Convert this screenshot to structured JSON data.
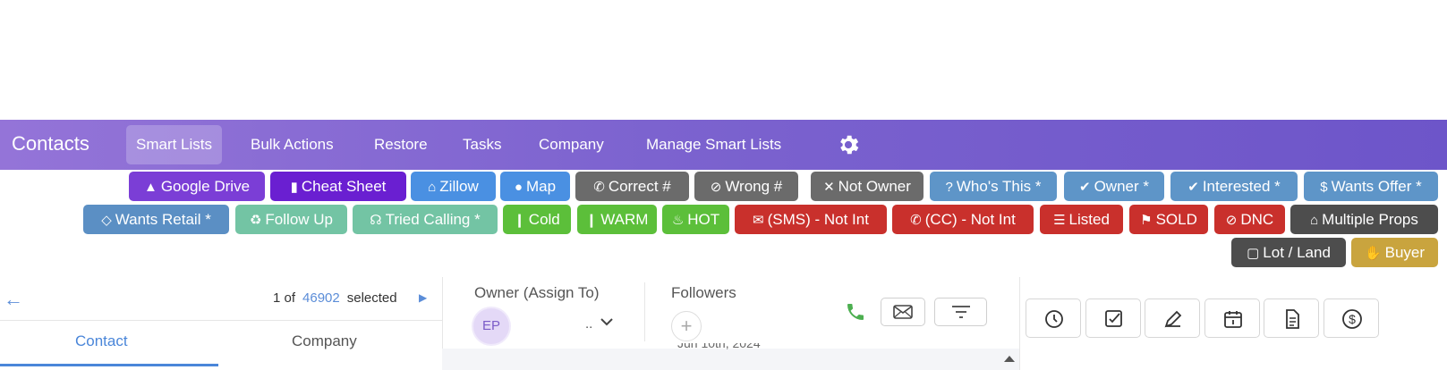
{
  "header": {
    "title": "Contacts",
    "nav": [
      {
        "label": "Smart Lists",
        "active": true
      },
      {
        "label": "Bulk Actions",
        "active": false
      },
      {
        "label": "Restore",
        "active": false
      },
      {
        "label": "Tasks",
        "active": false
      },
      {
        "label": "Company",
        "active": false
      },
      {
        "label": "Manage Smart Lists",
        "active": false
      }
    ],
    "settings_icon": "gear-icon"
  },
  "tags": [
    {
      "label": "Google Drive",
      "icon": "drive-icon",
      "color": "#7b3ed6"
    },
    {
      "label": "Cheat Sheet",
      "icon": "book-icon",
      "color": "#6a1fd1"
    },
    {
      "label": "Zillow",
      "icon": "home-icon",
      "color": "#4a90e2"
    },
    {
      "label": "Map",
      "icon": "map-pin-icon",
      "color": "#4a90e2"
    },
    {
      "label": "Correct #",
      "icon": "phone-icon",
      "color": "#6b6b6b"
    },
    {
      "label": "Wrong #",
      "icon": "phone-slash-icon",
      "color": "#6b6b6b"
    },
    {
      "label": "Not Owner",
      "icon": "x-icon",
      "color": "#6b6b6b"
    },
    {
      "label": "Who's This *",
      "icon": "question-icon",
      "color": "#5e95c8"
    },
    {
      "label": "Owner *",
      "icon": "check-icon",
      "color": "#5e95c8"
    },
    {
      "label": "Interested *",
      "icon": "check-icon",
      "color": "#5e95c8"
    },
    {
      "label": "Wants Offer *",
      "icon": "dollar-icon",
      "color": "#5e95c8"
    },
    {
      "label": "Wants Retail *",
      "icon": "diamond-icon",
      "color": "#5b8fc4"
    },
    {
      "label": "Follow Up",
      "icon": "recycle-icon",
      "color": "#73c4a4"
    },
    {
      "label": "Tried Calling *",
      "icon": "headset-icon",
      "color": "#73c4a4"
    },
    {
      "label": "Cold",
      "icon": "thermometer-icon",
      "color": "#5cbf3a"
    },
    {
      "label": "WARM",
      "icon": "thermometer-icon",
      "color": "#5cbf3a"
    },
    {
      "label": "HOT",
      "icon": "fire-icon",
      "color": "#5cbf3a"
    },
    {
      "label": "(SMS) - Not Int",
      "icon": "comments-icon",
      "color": "#c9302c"
    },
    {
      "label": "(CC) - Not Int",
      "icon": "phone-icon",
      "color": "#c9302c"
    },
    {
      "label": "Listed",
      "icon": "list-icon",
      "color": "#c9302c"
    },
    {
      "label": "SOLD",
      "icon": "flag-icon",
      "color": "#c9302c"
    },
    {
      "label": "DNC",
      "icon": "ban-icon",
      "color": "#c9302c"
    },
    {
      "label": "Multiple Props",
      "icon": "home-icon",
      "color": "#4d4d4d"
    },
    {
      "label": "Lot / Land",
      "icon": "vector-square-icon",
      "color": "#4d4d4d"
    },
    {
      "label": "Buyer",
      "icon": "handshake-icon",
      "color": "#c9a43e"
    }
  ],
  "pager": {
    "prefix": "1 of",
    "total": "46902",
    "suffix": "selected"
  },
  "tabs": {
    "contact": "Contact",
    "company": "Company"
  },
  "owner": {
    "label": "Owner (Assign To)",
    "initials": "EP",
    "value": ".."
  },
  "followers": {
    "label": "Followers"
  },
  "activity": {
    "date_partial": "Jun 10th, 2024"
  },
  "actions": [
    "history-icon",
    "task-icon",
    "note-icon",
    "calendar-icon",
    "document-icon",
    "dollar-circle-icon"
  ]
}
